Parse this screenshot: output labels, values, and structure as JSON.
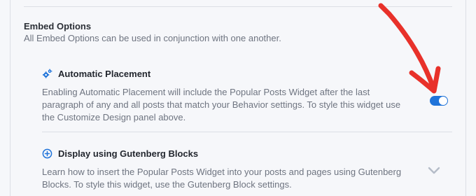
{
  "embed": {
    "title": "Embed Options",
    "description": "All Embed Options can be used in conjunction with one another."
  },
  "options": [
    {
      "icon": "gears-icon",
      "title": "Automatic Placement",
      "description": "Enabling Automatic Placement will include the Popular Posts Widget after the last paragraph of any and all posts that match your Behavior settings. To style this widget use the Customize Design panel above.",
      "enabled": true
    },
    {
      "icon": "plus-circle-icon",
      "title": "Display using Gutenberg Blocks",
      "description": "Learn how to insert the Popular Posts Widget into your posts and pages using Gutenberg Blocks. To style this widget, use the Gutenberg Block settings.",
      "expanded": false
    }
  ],
  "colors": {
    "accent": "#1f73d9",
    "annotation_arrow": "#e8312a",
    "heading": "#23272f",
    "muted_text": "#6e7480",
    "background": "#f6f7fa",
    "divider": "#dcdfe5"
  }
}
